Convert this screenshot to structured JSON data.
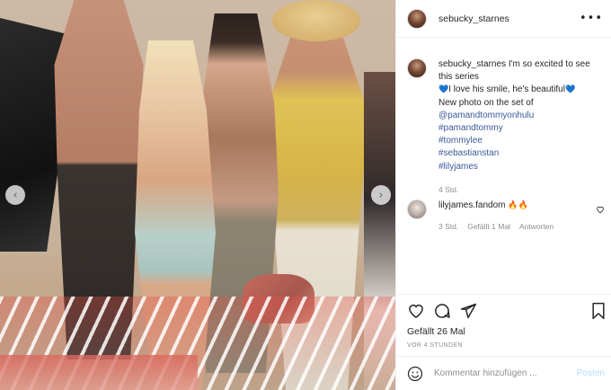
{
  "photo": {
    "prev_arrow": "‹",
    "next_arrow": "›"
  },
  "header": {
    "username": "sebucky_starnes",
    "more": "•••"
  },
  "caption": {
    "username": "sebucky_starnes",
    "text_first": "I'm so excited to see this series",
    "heart_left": "💙",
    "text_love": "I love his smile, he's beautiful",
    "heart_right": "💙",
    "text_photo": "New photo on the set of",
    "mentions": [
      "@pamandtommyonhulu",
      "#pamandtommy",
      "#tommylee",
      "#sebastianstan",
      "#lilyjames"
    ],
    "time": "4 Std."
  },
  "comment": {
    "username": "lilyjames.fandom",
    "emoji": "🔥🔥",
    "time": "3 Std.",
    "likes": "Gefällt 1 Mal",
    "reply": "Antworten"
  },
  "actions": {
    "likes": "Gefällt 26 Mal",
    "time_ago": "VOR 4 STUNDEN",
    "icons": [
      "heart-icon",
      "comment-icon",
      "share-icon",
      "bookmark-icon"
    ]
  },
  "composer": {
    "placeholder": "Kommentar hinzufügen ...",
    "post_label": "Posten"
  },
  "colors": {
    "link": "#3b5998",
    "meta": "#8e8e8e",
    "post_button": "#b2dffc"
  }
}
